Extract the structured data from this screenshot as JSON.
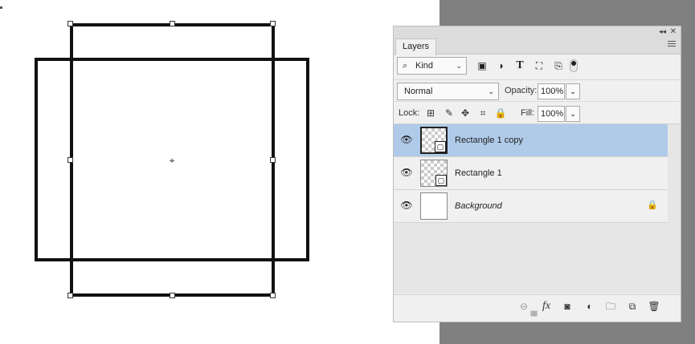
{
  "panel": {
    "tab_label": "Layers",
    "collapse_glyph": "◂◂",
    "close_glyph": "✕"
  },
  "filter": {
    "kind_label": "Kind",
    "search_glyph": "⌕",
    "chevron": "⌄",
    "icons": [
      "pixel-layer-filter-icon",
      "adjustment-layer-filter-icon",
      "type-layer-filter-icon",
      "shape-layer-filter-icon",
      "smart-object-filter-icon"
    ]
  },
  "blend": {
    "mode": "Normal",
    "opacity_label": "Opacity:",
    "opacity_value": "100%"
  },
  "lock": {
    "label": "Lock:",
    "fill_label": "Fill:",
    "fill_value": "100%"
  },
  "layers": [
    {
      "name": "Rectangle 1 copy",
      "selected": true,
      "type": "shape",
      "visible": true
    },
    {
      "name": "Rectangle 1",
      "selected": false,
      "type": "shape",
      "visible": true
    },
    {
      "name": "Background",
      "selected": false,
      "type": "background",
      "visible": true,
      "locked": true
    }
  ],
  "bottom_bar": {
    "fx_label": "fx"
  },
  "colors": {
    "selection": "#b0cbe9",
    "pasteboard": "#808080",
    "panel_bg": "#f0f0f0"
  }
}
